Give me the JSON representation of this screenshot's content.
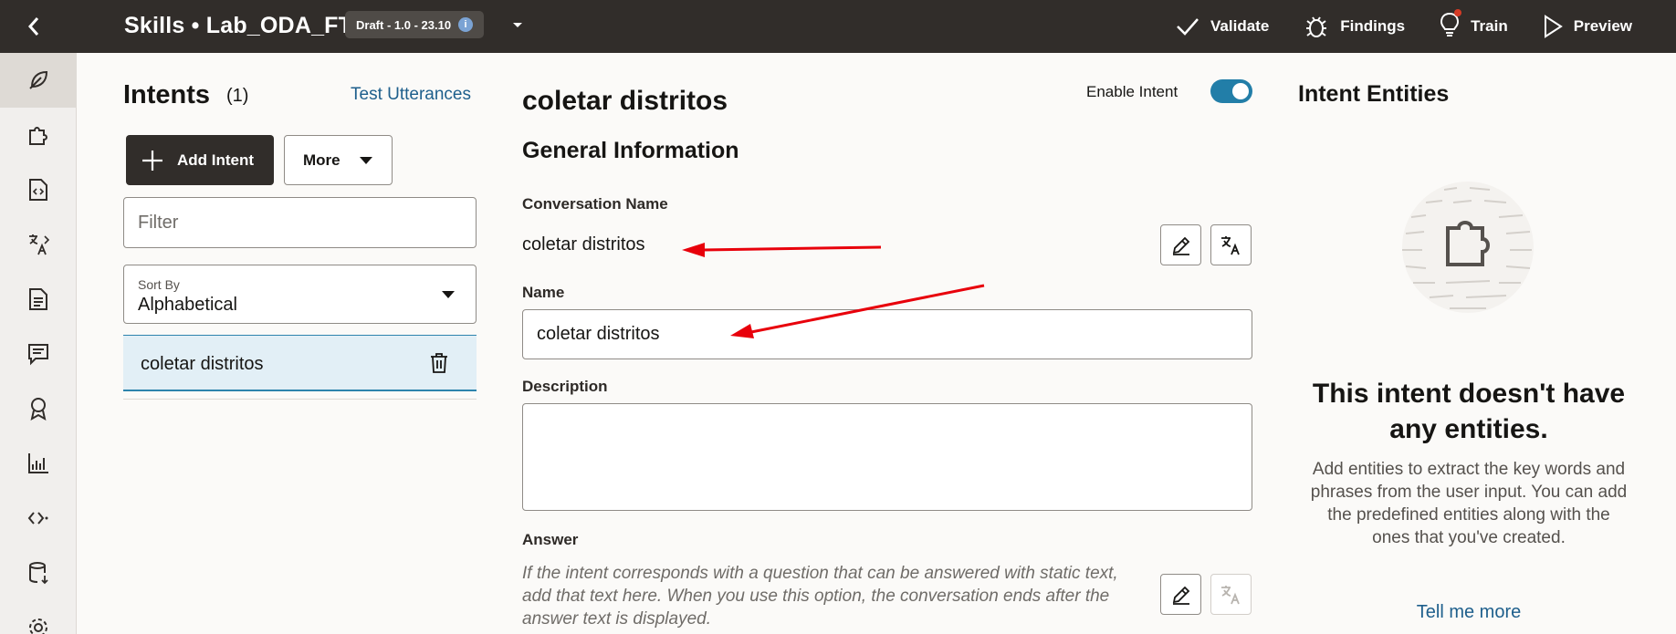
{
  "topbar": {
    "title": "Skills • Lab_ODA_FT",
    "version_badge": "Draft - 1.0 - 23.10",
    "actions": [
      {
        "label": "Validate",
        "icon": "check-icon"
      },
      {
        "label": "Findings",
        "icon": "bug-icon"
      },
      {
        "label": "Train",
        "icon": "lightbulb-icon"
      },
      {
        "label": "Preview",
        "icon": "play-icon"
      }
    ]
  },
  "rail": {
    "items": [
      "feather-icon",
      "puzzle-icon",
      "code-file-icon",
      "translate-icon",
      "document-icon",
      "chat-icon",
      "badge-icon",
      "chart-icon",
      "share-icon",
      "database-icon",
      "gear-icon"
    ]
  },
  "left": {
    "title": "Intents",
    "count": "(1)",
    "test_utterances": "Test Utterances",
    "add_intent": "Add Intent",
    "more": "More",
    "filter_placeholder": "Filter",
    "sort_label": "Sort By",
    "sort_value": "Alphabetical",
    "intents": [
      {
        "name": "coletar distritos"
      }
    ]
  },
  "main": {
    "title": "coletar distritos",
    "enable_label": "Enable Intent",
    "enabled": true,
    "section_title": "General Information",
    "conversation_name_label": "Conversation Name",
    "conversation_name": "coletar distritos",
    "name_label": "Name",
    "name_value": "coletar distritos",
    "description_label": "Description",
    "description_value": "",
    "answer_label": "Answer",
    "answer_help": "If the intent corresponds with a question that can be answered with static text, add that text here. When you use this option, the conversation ends after the answer text is displayed."
  },
  "right": {
    "title": "Intent Entities",
    "empty_heading": "This intent doesn't have any entities.",
    "empty_text": "Add entities to extract the key words and phrases from the user input. You can add the predefined entities along with the ones that you've created.",
    "tell_more": "Tell me more"
  },
  "colors": {
    "topbar": "#312d2a",
    "accent": "#227ea8",
    "link": "#1e5f8c",
    "selected_row": "#e2eff6",
    "annotation_arrow": "#e8000b"
  }
}
